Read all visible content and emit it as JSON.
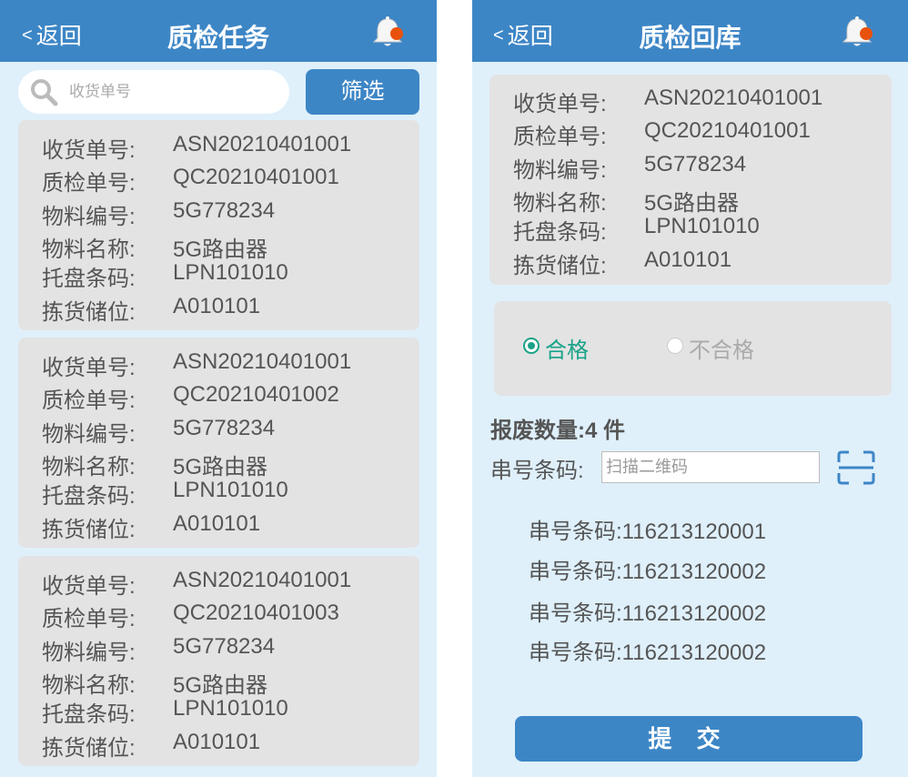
{
  "left_screen": {
    "back_label": "返回",
    "title": "质检任务",
    "search": {
      "placeholder": "收货单号"
    },
    "filter_label": "筛选",
    "tasks": [
      {
        "fields": [
          {
            "label": "收货单号:",
            "value": "ASN20210401001"
          },
          {
            "label": "质检单号:",
            "value": "QC20210401001"
          },
          {
            "label": "物料编号:",
            "value": "5G778234"
          },
          {
            "label": "物料名称:",
            "value": "5G路由器"
          },
          {
            "label": "托盘条码:",
            "value": "LPN101010"
          },
          {
            "label": "拣货储位:",
            "value": "A010101"
          }
        ]
      },
      {
        "fields": [
          {
            "label": "收货单号:",
            "value": "ASN20210401001"
          },
          {
            "label": "质检单号:",
            "value": "QC20210401002"
          },
          {
            "label": "物料编号:",
            "value": "5G778234"
          },
          {
            "label": "物料名称:",
            "value": "5G路由器"
          },
          {
            "label": "托盘条码:",
            "value": "LPN101010"
          },
          {
            "label": "拣货储位:",
            "value": "A010101"
          }
        ]
      },
      {
        "fields": [
          {
            "label": "收货单号:",
            "value": "ASN20210401001"
          },
          {
            "label": "质检单号:",
            "value": "QC20210401003"
          },
          {
            "label": "物料编号:",
            "value": "5G778234"
          },
          {
            "label": "物料名称:",
            "value": "5G路由器"
          },
          {
            "label": "托盘条码:",
            "value": "LPN101010"
          },
          {
            "label": "拣货储位:",
            "value": "A010101"
          }
        ]
      }
    ]
  },
  "right_screen": {
    "back_label": "返回",
    "title": "质检回库",
    "info": [
      {
        "label": "收货单号:",
        "value": "ASN20210401001"
      },
      {
        "label": "质检单号:",
        "value": "QC20210401001"
      },
      {
        "label": "物料编号:",
        "value": "5G778234"
      },
      {
        "label": "物料名称:",
        "value": "5G路由器"
      },
      {
        "label": "托盘条码:",
        "value": "LPN101010"
      },
      {
        "label": "拣货储位:",
        "value": "A010101"
      }
    ],
    "qc_result": {
      "pass_label": "合格",
      "fail_label": "不合格",
      "selected": "合格"
    },
    "scrap_label": "报废数量:",
    "scrap_count": "4 件",
    "serial_label": "串号条码:",
    "serial_placeholder": "扫描二维码",
    "serials": [
      {
        "label": "串号条码:",
        "value": "116213120001"
      },
      {
        "label": "串号条码:",
        "value": "116213120002"
      },
      {
        "label": "串号条码:",
        "value": "116213120002"
      },
      {
        "label": "串号条码:",
        "value": "116213120002"
      }
    ],
    "submit_label": "提 交"
  },
  "colors": {
    "header": "#3d86c6",
    "background": "#dff0fb",
    "card": "#e3e3e3",
    "text": "#555555",
    "radio_selected": "#1aa389",
    "radio_unselected": "#aaaaaa",
    "bell_dot": "#e8520c"
  },
  "icons": {
    "back": "chevron-left-icon",
    "notification": "bell-icon",
    "search": "search-icon",
    "scan": "scan-icon"
  }
}
